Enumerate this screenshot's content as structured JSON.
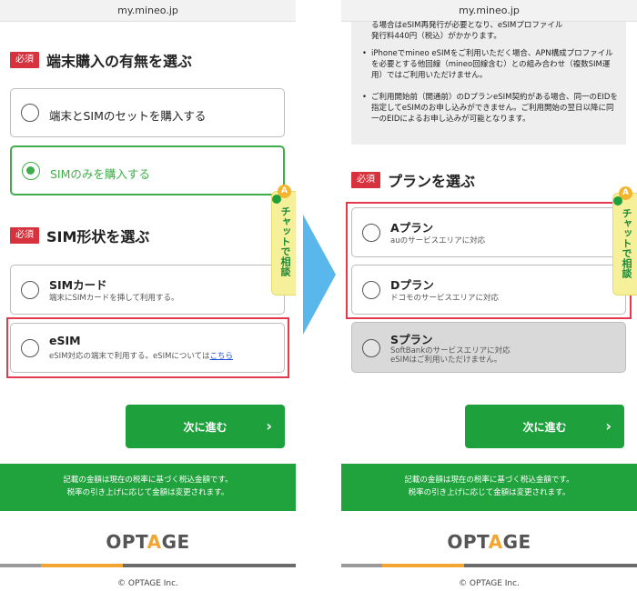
{
  "left": {
    "url": "my.mineo.jp",
    "section1": {
      "badge": "必須",
      "title": "端末購入の有無を選ぶ"
    },
    "option_set": {
      "label": "端末とSIMのセットを購入する"
    },
    "option_sim_only": {
      "label": "SIMのみを購入する",
      "selected": true
    },
    "section2": {
      "badge": "必須",
      "title": "SIM形状を選ぶ"
    },
    "option_sim_card": {
      "title": "SIMカード",
      "sub": "端末にSIMカードを挿して利用する。"
    },
    "option_esim": {
      "title": "eSIM",
      "sub": "eSIM対応の端末で利用する。eSIMについては",
      "link": "こちら"
    },
    "next_label": "次に進む",
    "footer_line1": "記載の金額は現在の税率に基づく税込金額です。",
    "footer_line2": "税率の引き上げに応じて金額は変更されます。",
    "logo_pre": "OPT",
    "logo_mid": "A",
    "logo_post": "GE",
    "copyright": "© OPTAGE Inc.",
    "chat_badge": "A",
    "chat_text": "チャットで相談"
  },
  "right": {
    "url": "my.mineo.jp",
    "note0_line1": "る場合はeSIM再発行が必要となり、eSIMプロファイル",
    "note0_line2": "発行料440円（税込）がかかります。",
    "note1_bullet": "•",
    "note1_text": "iPhoneでmineo eSIMをご利用いただく場合、APN構成プロファイルを必要とする他回線（mineo回線含む）との組み合わせ（複数SIM運用）ではご利用いただけません。",
    "note2_bullet": "•",
    "note2_text": "ご利用開始前（開通前）のDプランeSIM契約がある場合、同一のEIDを指定してeSIMのお申し込みができません。ご利用開始の翌日以降に同一のEIDによるお申し込みが可能となります。",
    "section": {
      "badge": "必須",
      "title": "プランを選ぶ"
    },
    "plan_a": {
      "title": "Aプラン",
      "sub": "auのサービスエリアに対応"
    },
    "plan_d": {
      "title": "Dプラン",
      "sub": "ドコモのサービスエリアに対応"
    },
    "plan_s": {
      "title": "Sプラン",
      "sub1": "SoftBankのサービスエリアに対応",
      "sub2": "eSIMはご利用いただけません。"
    },
    "next_label": "次に進む",
    "footer_line1": "記載の金額は現在の税率に基づく税込金額です。",
    "footer_line2": "税率の引き上げに応じて金額は変更されます。",
    "logo_pre": "OPT",
    "logo_mid": "A",
    "logo_post": "GE",
    "copyright": "© OPTAGE Inc.",
    "chat_badge": "A",
    "chat_text": "チャットで相談"
  },
  "colors": {
    "accent_green": "#1ea03c",
    "required_red": "#d6333e",
    "highlight_red": "#e23a4e",
    "arrow_blue": "#5ab7ec",
    "link_blue": "#1a4fd6"
  }
}
